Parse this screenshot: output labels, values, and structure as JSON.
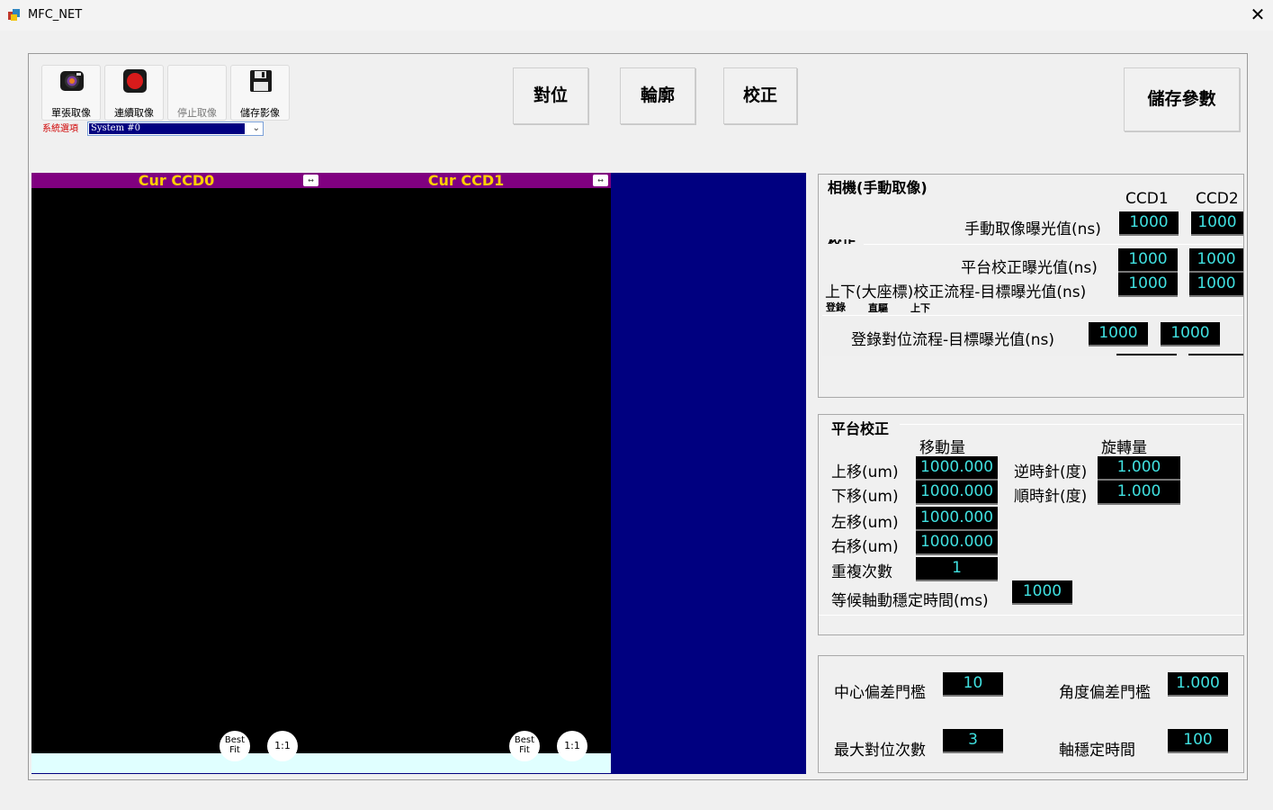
{
  "window": {
    "title": "MFC_NET",
    "close_glyph": "✕"
  },
  "toolbar": {
    "single_capture": "單張取像",
    "continuous_capture": "連續取像",
    "stop_capture": "停止取像",
    "save_image": "儲存影像",
    "system_option_label": "系統選項",
    "system_option_value": "System #0"
  },
  "main_buttons": {
    "align": "對位",
    "contour": "輪廓",
    "calibrate": "校正",
    "save_params": "儲存參數"
  },
  "views": [
    {
      "title": "Cur CCD0",
      "best_fit": "Best Fit",
      "one_to_one": "1:1"
    },
    {
      "title": "Cur CCD1",
      "best_fit": "Best Fit",
      "one_to_one": "1:1"
    }
  ],
  "camera": {
    "title": "相機(手動取像)",
    "col1": "CCD1",
    "col2": "CCD2",
    "manual_exposure_label": "手動取像曝光值(ns)",
    "manual_exposure": [
      "1000",
      "1000"
    ],
    "calib_title_partial": "校正",
    "platform_calib_exposure_label": "平台校正曝光值(ns)",
    "platform_calib_exposure": [
      "1000",
      "1000"
    ],
    "updown_calib_exposure_label": "上下(大座標)校正流程-目標曝光值(ns)",
    "updown_calib_exposure": [
      "1000",
      "1000"
    ],
    "tabs": [
      "登錄",
      "直驅",
      "上下"
    ],
    "register_align_exposure_label": "登錄對位流程-目標曝光值(ns)",
    "register_align_exposure": [
      "1000",
      "1000"
    ]
  },
  "platform": {
    "title": "平台校正",
    "move_header": "移動量",
    "rotate_header": "旋轉量",
    "up_label": "上移(um)",
    "up": "1000.000",
    "down_label": "下移(um)",
    "down": "1000.000",
    "left_label": "左移(um)",
    "left": "1000.000",
    "right_label": "右移(um)",
    "right": "1000.000",
    "repeat_label": "重複次數",
    "repeat": "1",
    "ccw_label": "逆時針(度)",
    "ccw": "1.000",
    "cw_label": "順時針(度)",
    "cw": "1.000",
    "wait_label": "等候軸動穩定時間(ms)",
    "wait": "1000"
  },
  "thresholds": {
    "center_label": "中心偏差門檻",
    "center": "10",
    "angle_label": "角度偏差門檻",
    "angle": "1.000",
    "max_align_label": "最大對位次數",
    "max_align": "3",
    "settle_label": "軸穩定時間",
    "settle": "100"
  }
}
